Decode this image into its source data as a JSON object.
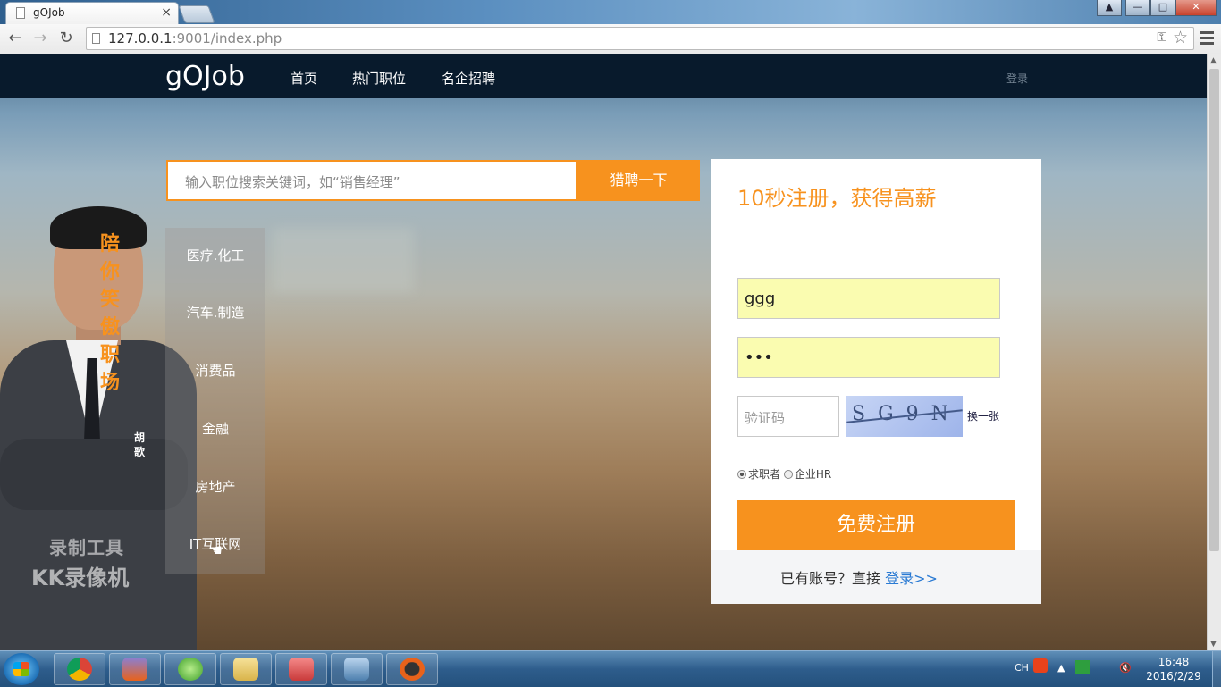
{
  "browser": {
    "tab_title": "gOJob",
    "tab_close": "×",
    "url_host": "127.0.0.1",
    "url_rest": ":9001/index.php",
    "window_buttons": {
      "help": "▲",
      "minimize": "—",
      "maximize": "□",
      "close": "✕"
    }
  },
  "site": {
    "logo": "gOJob",
    "nav": {
      "home": "首页",
      "hot_jobs": "热门职位",
      "top_companies": "名企招聘"
    },
    "login_link": "登录"
  },
  "search": {
    "placeholder": "输入职位搜索关键词，如“销售经理”",
    "button": "猎聘一下"
  },
  "categories": [
    "医疗.化工",
    "汽车.制造",
    "消费品",
    "金融",
    "房地产",
    "IT互联网"
  ],
  "banner": {
    "slogan": "陪你笑傲职场",
    "signature": "胡歌",
    "watermark_line1": "录制工具",
    "watermark_line2": "KK录像机"
  },
  "register": {
    "title": "10秒注册，获得高薪",
    "username_value": "ggg",
    "password_value": "•••",
    "captcha_placeholder": "验证码",
    "captcha_text": "SG9N",
    "captcha_refresh": "换一张",
    "role_seeker": "求职者",
    "role_hr": "企业HR",
    "submit": "免费注册",
    "have_account": "已有账号？直接",
    "login_link": "登录>>"
  },
  "taskbar": {
    "ime": "CH",
    "time": "16:48",
    "date": "2016/2/29"
  },
  "colors": {
    "accent": "#f7921e",
    "nav_bg": "#081a2c",
    "link": "#2a7ad3",
    "field_bg": "#fafcb0"
  }
}
